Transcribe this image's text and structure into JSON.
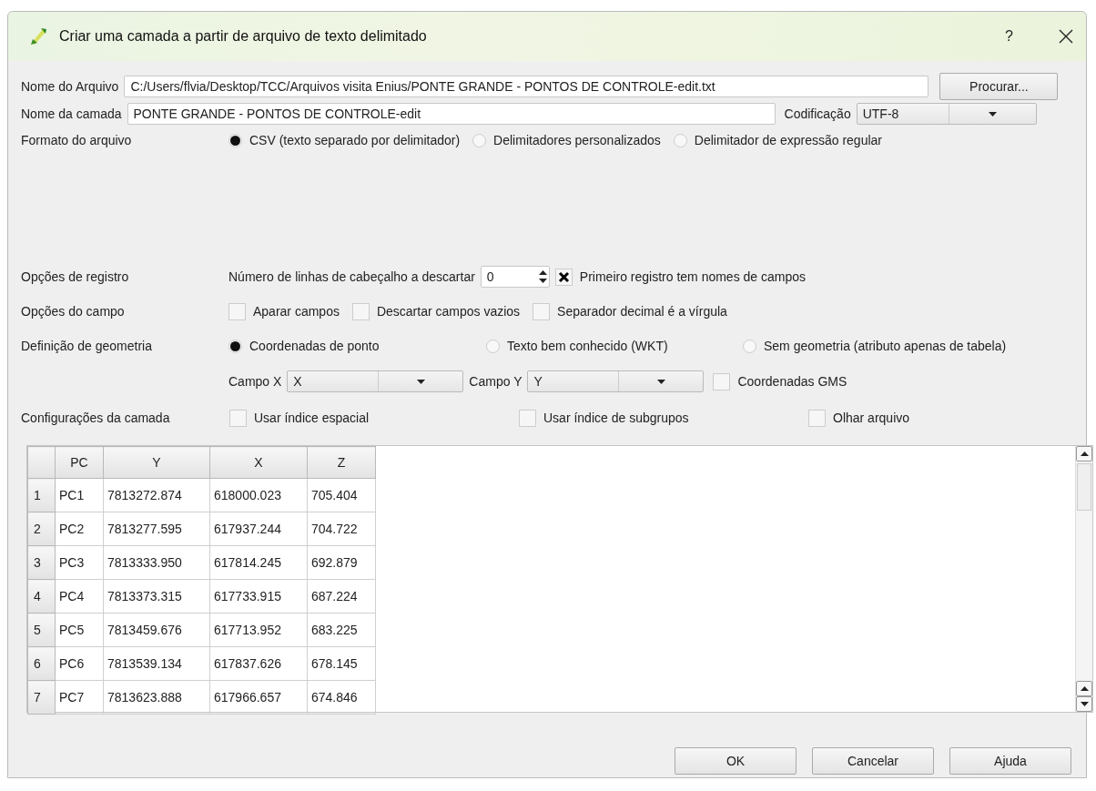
{
  "window": {
    "title": "Criar uma camada a partir de arquivo de texto delimitado",
    "help": "?"
  },
  "file_name": {
    "label": "Nome do Arquivo",
    "value": "C:/Users/flvia/Desktop/TCC/Arquivos visita Enius/PONTE GRANDE - PONTOS DE CONTROLE-edit.txt",
    "button": "Procurar..."
  },
  "layer_name": {
    "label": "Nome da camada",
    "value": "PONTE GRANDE - PONTOS DE CONTROLE-edit"
  },
  "encoding": {
    "label": "Codificação",
    "value": "UTF-8"
  },
  "file_format": {
    "label": "Formato do arquivo",
    "options": [
      {
        "label": "CSV (texto separado por delimitador)",
        "selected": true
      },
      {
        "label": "Delimitadores personalizados",
        "selected": false
      },
      {
        "label": "Delimitador de expressão regular",
        "selected": false
      }
    ]
  },
  "record_options": {
    "label": "Opções de registro",
    "header_lines_label": "Número de linhas de cabeçalho a descartar",
    "header_lines_value": "0",
    "first_record": {
      "label": "Primeiro registro tem nomes de campos",
      "checked": true
    }
  },
  "field_options": {
    "label": "Opções do campo",
    "options": [
      {
        "label": "Aparar campos",
        "checked": false
      },
      {
        "label": "Descartar campos vazios",
        "checked": false
      },
      {
        "label": "Separador decimal é a vírgula",
        "checked": false
      }
    ]
  },
  "geometry": {
    "label": "Definição de geometria",
    "options": [
      {
        "label": "Coordenadas de ponto",
        "selected": true
      },
      {
        "label": "Texto bem conhecido (WKT)",
        "selected": false
      },
      {
        "label": "Sem geometria (atributo apenas de tabela)",
        "selected": false
      }
    ],
    "x_field": {
      "label": "Campo X",
      "value": "X"
    },
    "y_field": {
      "label": "Campo Y",
      "value": "Y"
    },
    "dms": {
      "label": "Coordenadas GMS",
      "checked": false
    }
  },
  "layer_settings": {
    "label": "Configurações da camada",
    "options": [
      {
        "label": "Usar índice espacial",
        "checked": false
      },
      {
        "label": "Usar índice de subgrupos",
        "checked": false
      },
      {
        "label": "Olhar arquivo",
        "checked": false
      }
    ]
  },
  "table": {
    "columns": [
      "PC",
      "Y",
      "X",
      "Z"
    ],
    "rows": [
      {
        "header": "1",
        "cells": [
          "PC1",
          "7813272.874",
          "618000.023",
          "705.404"
        ]
      },
      {
        "header": "2",
        "cells": [
          "PC2",
          "7813277.595",
          "617937.244",
          "704.722"
        ]
      },
      {
        "header": "3",
        "cells": [
          "PC3",
          "7813333.950",
          "617814.245",
          "692.879"
        ]
      },
      {
        "header": "4",
        "cells": [
          "PC4",
          "7813373.315",
          "617733.915",
          "687.224"
        ]
      },
      {
        "header": "5",
        "cells": [
          "PC5",
          "7813459.676",
          "617713.952",
          "683.225"
        ]
      },
      {
        "header": "6",
        "cells": [
          "PC6",
          "7813539.134",
          "617837.626",
          "678.145"
        ]
      },
      {
        "header": "7",
        "cells": [
          "PC7",
          "7813623.888",
          "617966.657",
          "674.846"
        ]
      }
    ]
  },
  "buttons": [
    "OK",
    "Cancelar",
    "Ajuda"
  ]
}
